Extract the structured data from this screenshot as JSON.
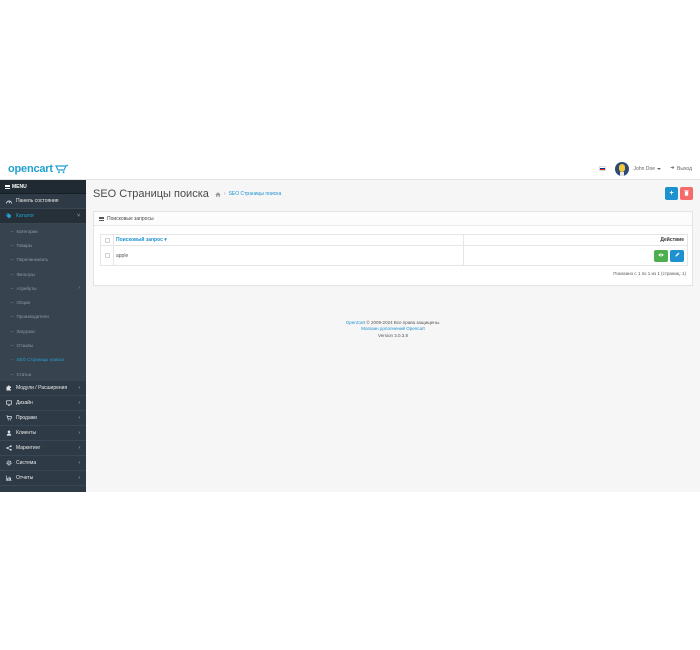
{
  "header": {
    "logo_text": "opencart",
    "user_name": "John Doe",
    "logout_label": "Выход",
    "flag_colors": [
      "#ffffff",
      "#0039a6",
      "#d52b1e"
    ]
  },
  "sidebar": {
    "menu_heading": "MENU",
    "items_top": [
      {
        "label": "Панель состояния",
        "icon": "dashboard-icon"
      },
      {
        "label": "Каталог",
        "icon": "tag-icon",
        "active": true
      }
    ],
    "catalog_sub": [
      {
        "label": "Категории"
      },
      {
        "label": "Товары"
      },
      {
        "label": "Перелинковать"
      },
      {
        "label": "Фильтры"
      },
      {
        "label": "Атрибуты",
        "has_children": true
      },
      {
        "label": "Опции"
      },
      {
        "label": "Производители"
      },
      {
        "label": "Загрузки"
      },
      {
        "label": "Отзывы"
      },
      {
        "label": "SEO Страницы поиска",
        "current": true
      },
      {
        "label": "Статьи"
      }
    ],
    "items_bottom": [
      {
        "label": "Модули / Расширения",
        "icon": "puzzle-icon"
      },
      {
        "label": "Дизайн",
        "icon": "monitor-icon"
      },
      {
        "label": "Продажи",
        "icon": "cart-icon"
      },
      {
        "label": "Клиенты",
        "icon": "user-icon"
      },
      {
        "label": "Маркетинг",
        "icon": "share-icon"
      },
      {
        "label": "Система",
        "icon": "gear-icon"
      },
      {
        "label": "Отчеты",
        "icon": "bar-chart-icon"
      }
    ]
  },
  "page": {
    "title": "SEO Страницы поиска",
    "breadcrumb": [
      "SEO Страницы поиска"
    ],
    "panel_title": "Поисковые запросы",
    "table": {
      "headers": {
        "query": "Поисковый запрос",
        "action": "Действие"
      },
      "rows": [
        {
          "query": "apple"
        }
      ]
    },
    "pagination_text": "Показано с 1 по 1 из 1 (страниц: 1)"
  },
  "footer": {
    "line1_link": "OpenCart",
    "line1_text": " © 2009-2024 Все права защищены.",
    "line2": "Магазин дополнений Opencart",
    "line3": "Version 3.0.3.8"
  },
  "colors": {
    "accent": "#1e91cf",
    "sidebar_bg": "#2e3a45",
    "danger": "#f56b6b",
    "success": "#4cae4c"
  }
}
